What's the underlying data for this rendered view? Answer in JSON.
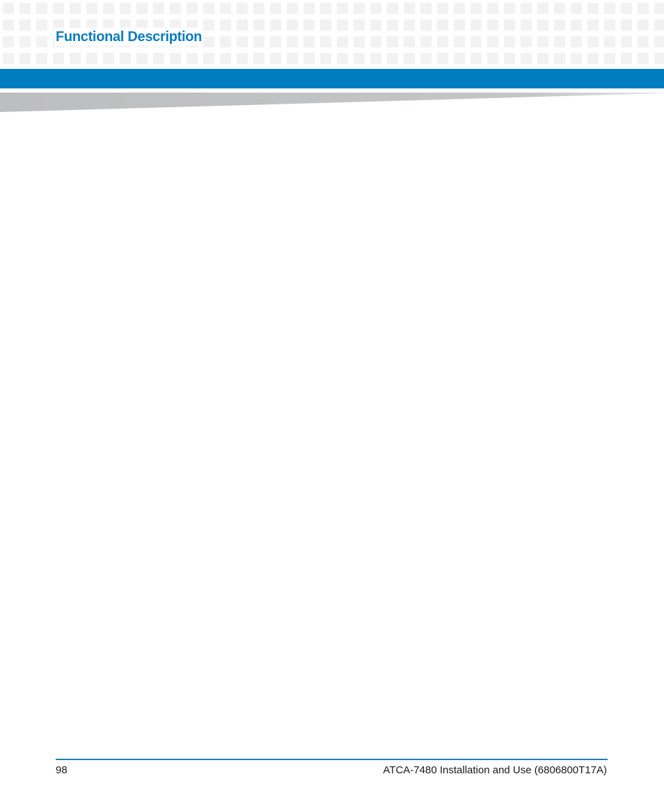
{
  "header": {
    "section_title": "Functional Description",
    "accent_color": "#007dbe"
  },
  "footer": {
    "page_number": "98",
    "document_title": "ATCA-7480 Installation and Use (6806800T17A)"
  }
}
